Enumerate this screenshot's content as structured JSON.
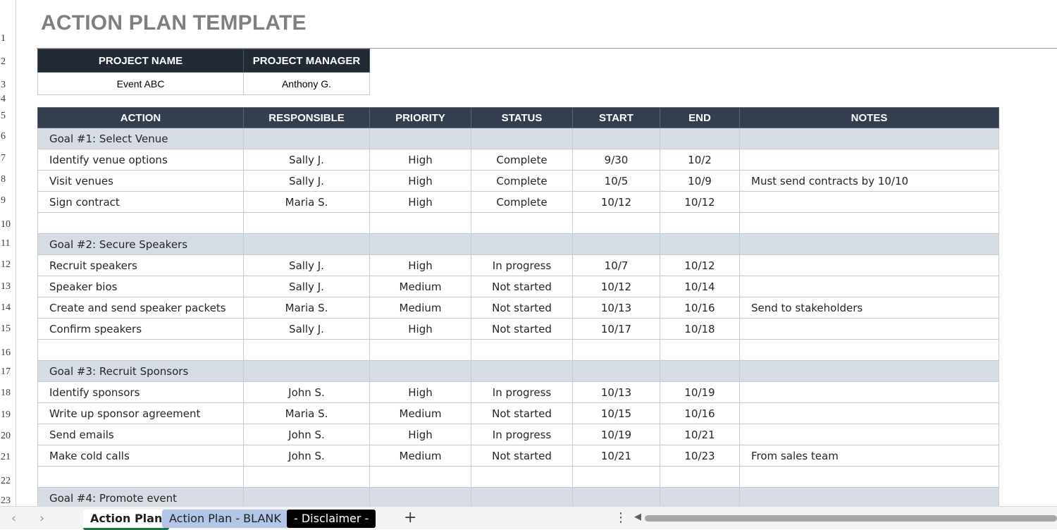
{
  "title": "ACTION PLAN TEMPLATE",
  "row_numbers": [
    "1",
    "2",
    "3",
    "4",
    "5",
    "6",
    "7",
    "8",
    "9",
    "10",
    "11",
    "12",
    "13",
    "14",
    "15",
    "16",
    "17",
    "18",
    "19",
    "20",
    "21",
    "22",
    "23"
  ],
  "project": {
    "headers": [
      "PROJECT NAME",
      "PROJECT MANAGER"
    ],
    "values": [
      "Event ABC",
      "Anthony G."
    ]
  },
  "table": {
    "headers": [
      "ACTION",
      "RESPONSIBLE",
      "PRIORITY",
      "STATUS",
      "START",
      "END",
      "NOTES"
    ],
    "rows": [
      {
        "type": "goal",
        "cells": [
          "Goal #1:  Select Venue",
          "",
          "",
          "",
          "",
          "",
          ""
        ]
      },
      {
        "type": "task",
        "cells": [
          "Identify venue options",
          "Sally J.",
          "High",
          "Complete",
          "9/30",
          "10/2",
          ""
        ]
      },
      {
        "type": "task",
        "cells": [
          "Visit venues",
          "Sally J.",
          "High",
          "Complete",
          "10/5",
          "10/9",
          "Must send contracts by 10/10"
        ]
      },
      {
        "type": "task",
        "cells": [
          "Sign contract",
          "Maria S.",
          "High",
          "Complete",
          "10/12",
          "10/12",
          ""
        ]
      },
      {
        "type": "blank",
        "cells": [
          "",
          "",
          "",
          "",
          "",
          "",
          ""
        ]
      },
      {
        "type": "goal",
        "cells": [
          "Goal #2: Secure Speakers",
          "",
          "",
          "",
          "",
          "",
          ""
        ]
      },
      {
        "type": "task",
        "cells": [
          "Recruit speakers",
          "Sally J.",
          "High",
          "In progress",
          "10/7",
          "10/12",
          ""
        ]
      },
      {
        "type": "task",
        "cells": [
          "Speaker bios",
          "Sally J.",
          "Medium",
          "Not started",
          "10/12",
          "10/14",
          ""
        ]
      },
      {
        "type": "task",
        "cells": [
          "Create and send speaker packets",
          "Maria S.",
          "Medium",
          "Not started",
          "10/13",
          "10/16",
          "Send to stakeholders"
        ]
      },
      {
        "type": "task",
        "cells": [
          "Confirm speakers",
          "Sally J.",
          "High",
          "Not started",
          "10/17",
          "10/18",
          ""
        ]
      },
      {
        "type": "blank",
        "cells": [
          "",
          "",
          "",
          "",
          "",
          "",
          ""
        ]
      },
      {
        "type": "goal",
        "cells": [
          "Goal #3: Recruit Sponsors",
          "",
          "",
          "",
          "",
          "",
          ""
        ]
      },
      {
        "type": "task",
        "cells": [
          "Identify sponsors",
          "John S.",
          "High",
          "In progress",
          "10/13",
          "10/19",
          ""
        ]
      },
      {
        "type": "task",
        "cells": [
          "Write up sponsor agreement",
          "Maria S.",
          "Medium",
          "Not started",
          "10/15",
          "10/16",
          ""
        ]
      },
      {
        "type": "task",
        "cells": [
          "Send emails",
          "John S.",
          "High",
          "In progress",
          "10/19",
          "10/21",
          ""
        ]
      },
      {
        "type": "task",
        "cells": [
          "Make cold calls",
          "John S.",
          "Medium",
          "Not started",
          "10/21",
          "10/23",
          "From sales team"
        ]
      },
      {
        "type": "blank",
        "cells": [
          "",
          "",
          "",
          "",
          "",
          "",
          ""
        ]
      },
      {
        "type": "goal",
        "cells": [
          "Goal #4: Promote event",
          "",
          "",
          "",
          "",
          "",
          ""
        ]
      }
    ]
  },
  "sheet_tabs": {
    "active": "Action Plan",
    "blank": "Action Plan - BLANK",
    "disclaimer": " - Disclaimer - ",
    "add": "+",
    "nav_prev": "‹",
    "nav_next": "›",
    "more": "⋮",
    "scroll_left": "◀"
  },
  "colors": {
    "header_dark": "#222b35",
    "header_main": "#333f4f",
    "goal_row": "#d6dce4",
    "tab_blank": "#b4c6e7",
    "tab_disclaimer": "#000000"
  }
}
